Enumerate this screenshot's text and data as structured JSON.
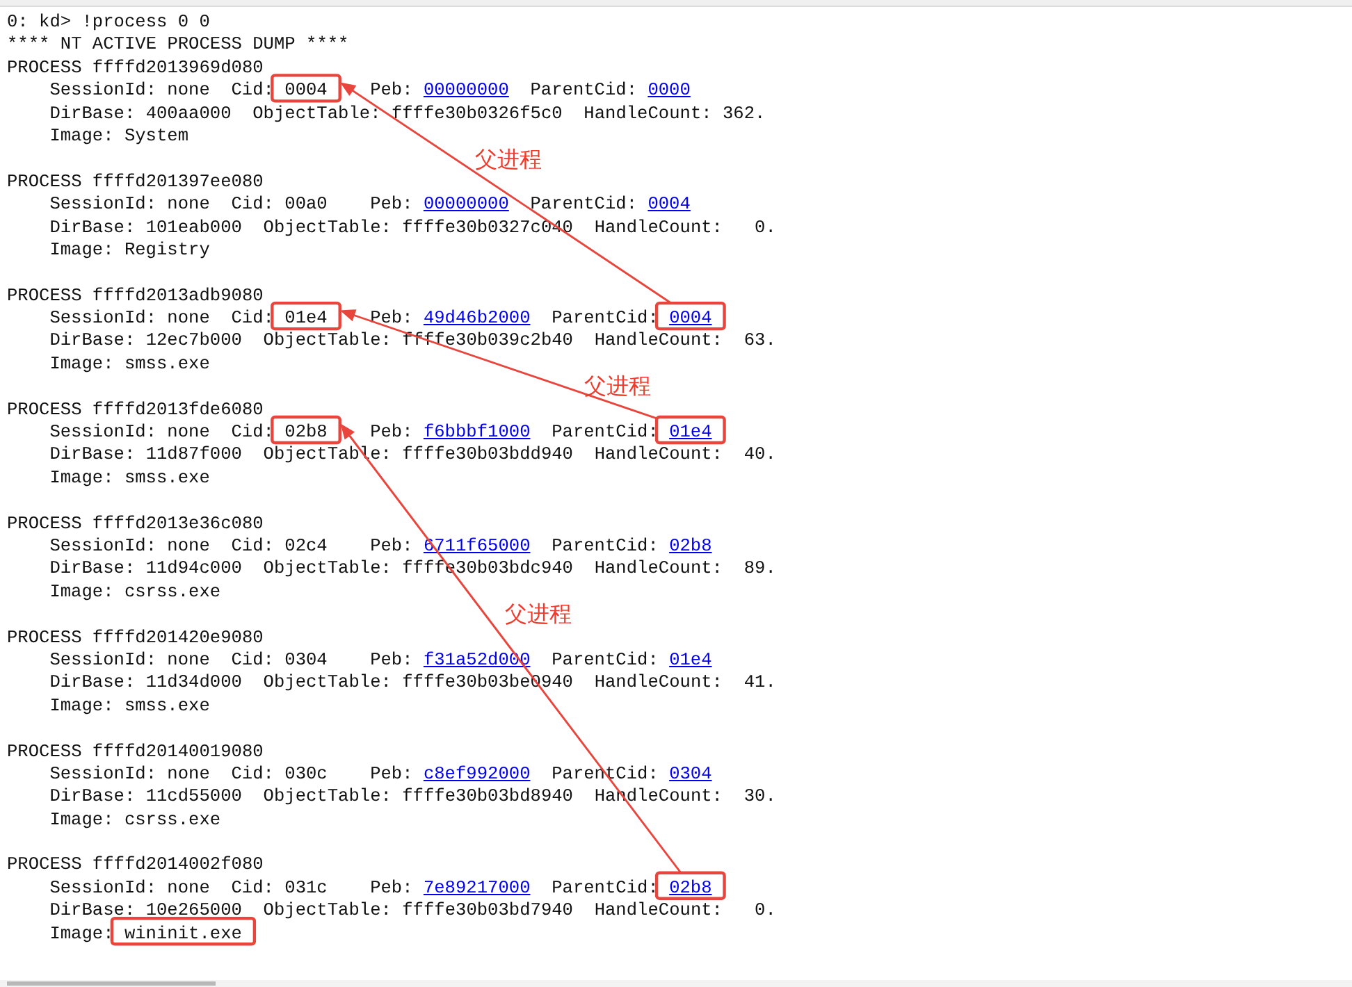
{
  "command": "0: kd> !process 0 0",
  "banner": "**** NT ACTIVE PROCESS DUMP ****",
  "processes": [
    {
      "header": "PROCESS ffffd2013969d080",
      "session": "SessionId: none",
      "cid_label": "Cid:",
      "cid": "0004",
      "peb_label": "Peb:",
      "peb": "00000000",
      "parent_label": "ParentCid:",
      "parent_cid": "0000",
      "dirbase": "DirBase: 400aa000",
      "object_table": "ObjectTable: ffffe30b0326f5c0",
      "handle_count": "HandleCount: 362.",
      "image_label": "Image:",
      "image": "System",
      "cid_marked": true,
      "parent_marked": false,
      "image_marked": false
    },
    {
      "header": "PROCESS ffffd201397ee080",
      "session": "SessionId: none",
      "cid_label": "Cid:",
      "cid": "00a0",
      "peb_label": "Peb:",
      "peb": "00000000",
      "parent_label": "ParentCid:",
      "parent_cid": "0004",
      "dirbase": "DirBase: 101eab000",
      "object_table": "ObjectTable: ffffe30b0327c040",
      "handle_count": "HandleCount:   0.",
      "image_label": "Image:",
      "image": "Registry",
      "cid_marked": false,
      "parent_marked": false,
      "image_marked": false
    },
    {
      "header": "PROCESS ffffd2013adb9080",
      "session": "SessionId: none",
      "cid_label": "Cid:",
      "cid": "01e4",
      "peb_label": "Peb:",
      "peb": "49d46b2000",
      "parent_label": "ParentCid:",
      "parent_cid": "0004",
      "dirbase": "DirBase: 12ec7b000",
      "object_table": "ObjectTable: ffffe30b039c2b40",
      "handle_count": "HandleCount:  63.",
      "image_label": "Image:",
      "image": "smss.exe",
      "cid_marked": true,
      "parent_marked": true,
      "image_marked": false
    },
    {
      "header": "PROCESS ffffd2013fde6080",
      "session": "SessionId: none",
      "cid_label": "Cid:",
      "cid": "02b8",
      "peb_label": "Peb:",
      "peb": "f6bbbf1000",
      "parent_label": "ParentCid:",
      "parent_cid": "01e4",
      "dirbase": "DirBase: 11d87f000",
      "object_table": "ObjectTable: ffffe30b03bdd940",
      "handle_count": "HandleCount:  40.",
      "image_label": "Image:",
      "image": "smss.exe",
      "cid_marked": true,
      "parent_marked": true,
      "image_marked": false
    },
    {
      "header": "PROCESS ffffd2013e36c080",
      "session": "SessionId: none",
      "cid_label": "Cid:",
      "cid": "02c4",
      "peb_label": "Peb:",
      "peb": "6711f65000",
      "parent_label": "ParentCid:",
      "parent_cid": "02b8",
      "dirbase": "DirBase: 11d94c000",
      "object_table": "ObjectTable: ffffe30b03bdc940",
      "handle_count": "HandleCount:  89.",
      "image_label": "Image:",
      "image": "csrss.exe",
      "cid_marked": false,
      "parent_marked": false,
      "image_marked": false
    },
    {
      "header": "PROCESS ffffd201420e9080",
      "session": "SessionId: none",
      "cid_label": "Cid:",
      "cid": "0304",
      "peb_label": "Peb:",
      "peb": "f31a52d000",
      "parent_label": "ParentCid:",
      "parent_cid": "01e4",
      "dirbase": "DirBase: 11d34d000",
      "object_table": "ObjectTable: ffffe30b03be0940",
      "handle_count": "HandleCount:  41.",
      "image_label": "Image:",
      "image": "smss.exe",
      "cid_marked": false,
      "parent_marked": false,
      "image_marked": false
    },
    {
      "header": "PROCESS ffffd20140019080",
      "session": "SessionId: none",
      "cid_label": "Cid:",
      "cid": "030c",
      "peb_label": "Peb:",
      "peb": "c8ef992000",
      "parent_label": "ParentCid:",
      "parent_cid": "0304",
      "dirbase": "DirBase: 11cd55000",
      "object_table": "ObjectTable: ffffe30b03bd8940",
      "handle_count": "HandleCount:  30.",
      "image_label": "Image:",
      "image": "csrss.exe",
      "cid_marked": false,
      "parent_marked": false,
      "image_marked": false
    },
    {
      "header": "PROCESS ffffd2014002f080",
      "session": "SessionId: none",
      "cid_label": "Cid:",
      "cid": "031c",
      "peb_label": "Peb:",
      "peb": "7e89217000",
      "parent_label": "ParentCid:",
      "parent_cid": "02b8",
      "dirbase": "DirBase: 10e265000",
      "object_table": "ObjectTable: ffffe30b03bd7940",
      "handle_count": "HandleCount:   0.",
      "image_label": "Image:",
      "image": "wininit.exe",
      "cid_marked": false,
      "parent_marked": true,
      "image_marked": true
    }
  ],
  "annotations": [
    {
      "label": "父进程"
    },
    {
      "label": "父进程"
    },
    {
      "label": "父进程"
    }
  ]
}
